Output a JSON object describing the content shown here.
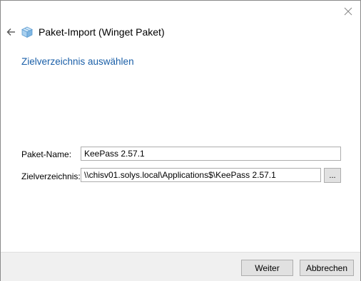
{
  "window": {
    "title": "Paket-Import (Winget Paket)"
  },
  "page": {
    "heading": "Zielverzeichnis auswählen"
  },
  "form": {
    "package_name_label": "Paket-Name:",
    "package_name_value": "KeePass 2.57.1",
    "target_dir_label": "Zielverzeichnis:",
    "target_dir_value": "\\\\chisv01.solys.local\\Applications$\\KeePass 2.57.1",
    "browse_label": "..."
  },
  "footer": {
    "next_label": "Weiter",
    "cancel_label": "Abbrechen"
  },
  "icons": {
    "close": "close-icon",
    "back": "back-arrow-icon",
    "app": "package-icon"
  },
  "colors": {
    "heading": "#1a5fa8",
    "footer_bg": "#f0f0f0"
  }
}
